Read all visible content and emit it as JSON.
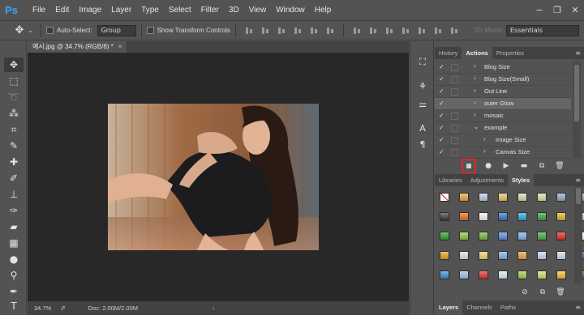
{
  "menubar": {
    "logo": "Ps",
    "items": [
      "File",
      "Edit",
      "Image",
      "Layer",
      "Type",
      "Select",
      "Filter",
      "3D",
      "View",
      "Window",
      "Help"
    ],
    "window_controls": [
      "−",
      "❐",
      "✕"
    ]
  },
  "options": {
    "move_icon": "✥",
    "caret": "⌄",
    "auto_select_label": "Auto-Select:",
    "group_value": "Group",
    "show_transform_label": "Show Transform Controls",
    "mode_3d_label": "3D Mode:",
    "workspace_value": "Essentials"
  },
  "document": {
    "tab_title": "예시.jpg @ 34.7% (RGB/8) *",
    "tab_close": "×",
    "zoom": "34.7%",
    "doc_info": "Doc: 2.00M/2.00M",
    "status_arrow": "›",
    "export_icon": "⇗"
  },
  "panels": {
    "top_tabs": [
      "History",
      "Actions",
      "Properties"
    ],
    "active_top_tab": "Actions",
    "actions": [
      {
        "label": "Blog Size",
        "arrow": "›",
        "indent": 0
      },
      {
        "label": "Blog Size(Small)",
        "arrow": "›",
        "indent": 0
      },
      {
        "label": "Out Line",
        "arrow": "›",
        "indent": 0
      },
      {
        "label": "outer Glow",
        "arrow": "›",
        "indent": 0,
        "selected": true
      },
      {
        "label": "mosaic",
        "arrow": "›",
        "indent": 0
      },
      {
        "label": "example",
        "arrow": "⌄",
        "indent": 0
      },
      {
        "label": "Image Size",
        "arrow": "›",
        "indent": 1
      },
      {
        "label": "Canvas Size",
        "arrow": "›",
        "indent": 1
      }
    ],
    "check_mark": "✓",
    "mid_tabs": [
      "Libraries",
      "Adjustments",
      "Styles"
    ],
    "active_mid_tab": "Styles",
    "bottom_tabs": [
      "Layers",
      "Channels",
      "Paths"
    ],
    "active_bottom_tab": "Layers",
    "menu_icon": "≡",
    "actions_footer_icons": [
      "stop-icon",
      "record-icon",
      "play-icon",
      "folder-icon",
      "new-action-icon",
      "trash-icon"
    ],
    "styles_footer_icons": [
      "clear-style-icon",
      "new-style-icon",
      "trash-icon"
    ]
  },
  "styles_swatches": [
    [
      "#ffffff",
      "#e8a53a",
      "#b7c8e8",
      "#e4c160",
      "#d9d9b0",
      "#cfe0a8",
      "#8ea8c8",
      "#a8a8a8"
    ],
    [
      "#3a3a3a",
      "#e07020",
      "#f0f0f0",
      "#3a72c0",
      "#2aa8d8",
      "#3aa040",
      "#e0b030",
      "#c8c8c8"
    ],
    [
      "#2e9e2e",
      "#90c040",
      "#78b840",
      "#5a8ad8",
      "#7ab0e8",
      "#48a848",
      "#e02828",
      "#ffffff"
    ],
    [
      "#e8a020",
      "#e0e0e0",
      "#f0d060",
      "#78b0e8",
      "#f0a040",
      "#c0d8f0",
      "#c8e0f0",
      "#3060b8"
    ],
    [
      "#3a8ad0",
      "#a0c0e0",
      "#e03030",
      "#d8e8f0",
      "#a0c850",
      "#c0e070",
      "#f0c030",
      "#2a7040"
    ]
  ]
}
